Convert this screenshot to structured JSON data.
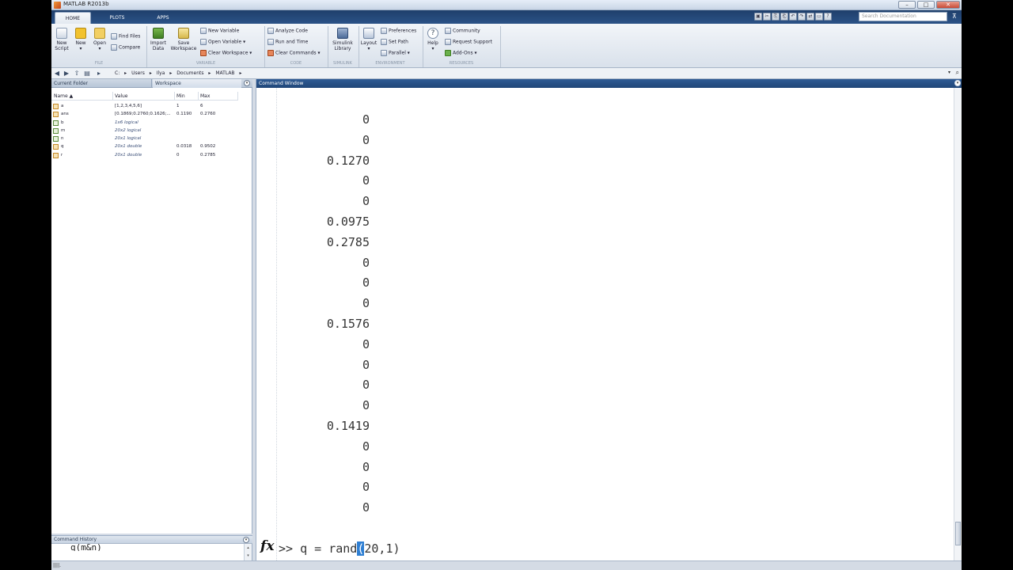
{
  "window": {
    "title": "MATLAB R2013b",
    "controls": [
      "–",
      "□",
      "✕"
    ]
  },
  "tabs": [
    "HOME",
    "PLOTS",
    "APPS"
  ],
  "search_placeholder": "Search Documentation",
  "quick_access": [
    "▣",
    "✂",
    "⎘",
    "⎗",
    "↶",
    "↷",
    "⇄",
    "▭",
    "?"
  ],
  "toolstrip": {
    "new_script": [
      "New",
      "Script"
    ],
    "new": "New",
    "open": "Open",
    "find_files": "Find Files",
    "compare": "Compare",
    "import_data": [
      "Import",
      "Data"
    ],
    "save_workspace": [
      "Save",
      "Workspace"
    ],
    "new_variable": "New Variable",
    "open_variable": "Open Variable ▾",
    "clear_workspace": "Clear Workspace ▾",
    "analyze_code": "Analyze Code",
    "run_and_time": "Run and Time",
    "clear_commands": "Clear Commands ▾",
    "simulink": [
      "Simulink",
      "Library"
    ],
    "layout": "Layout",
    "preferences": "Preferences",
    "set_path": "Set Path",
    "parallel": "Parallel ▾",
    "help": "Help",
    "community": "Community",
    "request_support": "Request Support",
    "add_ons": "Add-Ons ▾",
    "sections": [
      "FILE",
      "VARIABLE",
      "CODE",
      "SIMULINK",
      "ENVIRONMENT",
      "RESOURCES"
    ]
  },
  "breadcrumb": [
    "C:",
    "▸",
    "Users",
    "▸",
    "Ilya",
    "▸",
    "Documents",
    "▸",
    "MATLAB",
    "▸"
  ],
  "panels": {
    "current_folder": "Current Folder",
    "workspace": "Workspace",
    "command_history": "Command History",
    "command_window": "Command Window"
  },
  "workspace": {
    "columns": [
      "Name ▲",
      "Value",
      "Min",
      "Max"
    ],
    "rows": [
      {
        "name": "a",
        "value": "[1,2,3,4,5,6]",
        "min": "1",
        "max": "6"
      },
      {
        "name": "ans",
        "value": "[0.1869;0.2760;0.1626;...",
        "min": "0.1190",
        "max": "0.2760"
      },
      {
        "name": "b",
        "value": "1x6 logical",
        "min": "",
        "max": ""
      },
      {
        "name": "m",
        "value": "20x2 logical",
        "min": "",
        "max": ""
      },
      {
        "name": "n",
        "value": "20x1 logical",
        "min": "",
        "max": ""
      },
      {
        "name": "q",
        "value": "20x1 double",
        "min": "0.0318",
        "max": "0.9502"
      },
      {
        "name": "r",
        "value": "20x1 double",
        "min": "0",
        "max": "0.2785"
      }
    ]
  },
  "history_entry": "q(m&n)",
  "output_values": [
    "0",
    "0",
    "0.1270",
    "0",
    "0",
    "0.0975",
    "0.2785",
    "0",
    "0",
    "0",
    "0.1576",
    "0",
    "0",
    "0",
    "0",
    "0.1419",
    "0",
    "0",
    "0",
    "0"
  ],
  "command": {
    "fx": "fx",
    "before": ">> q = rand",
    "selected": "(",
    "after": "20,1)"
  },
  "statusbar": "||||."
}
